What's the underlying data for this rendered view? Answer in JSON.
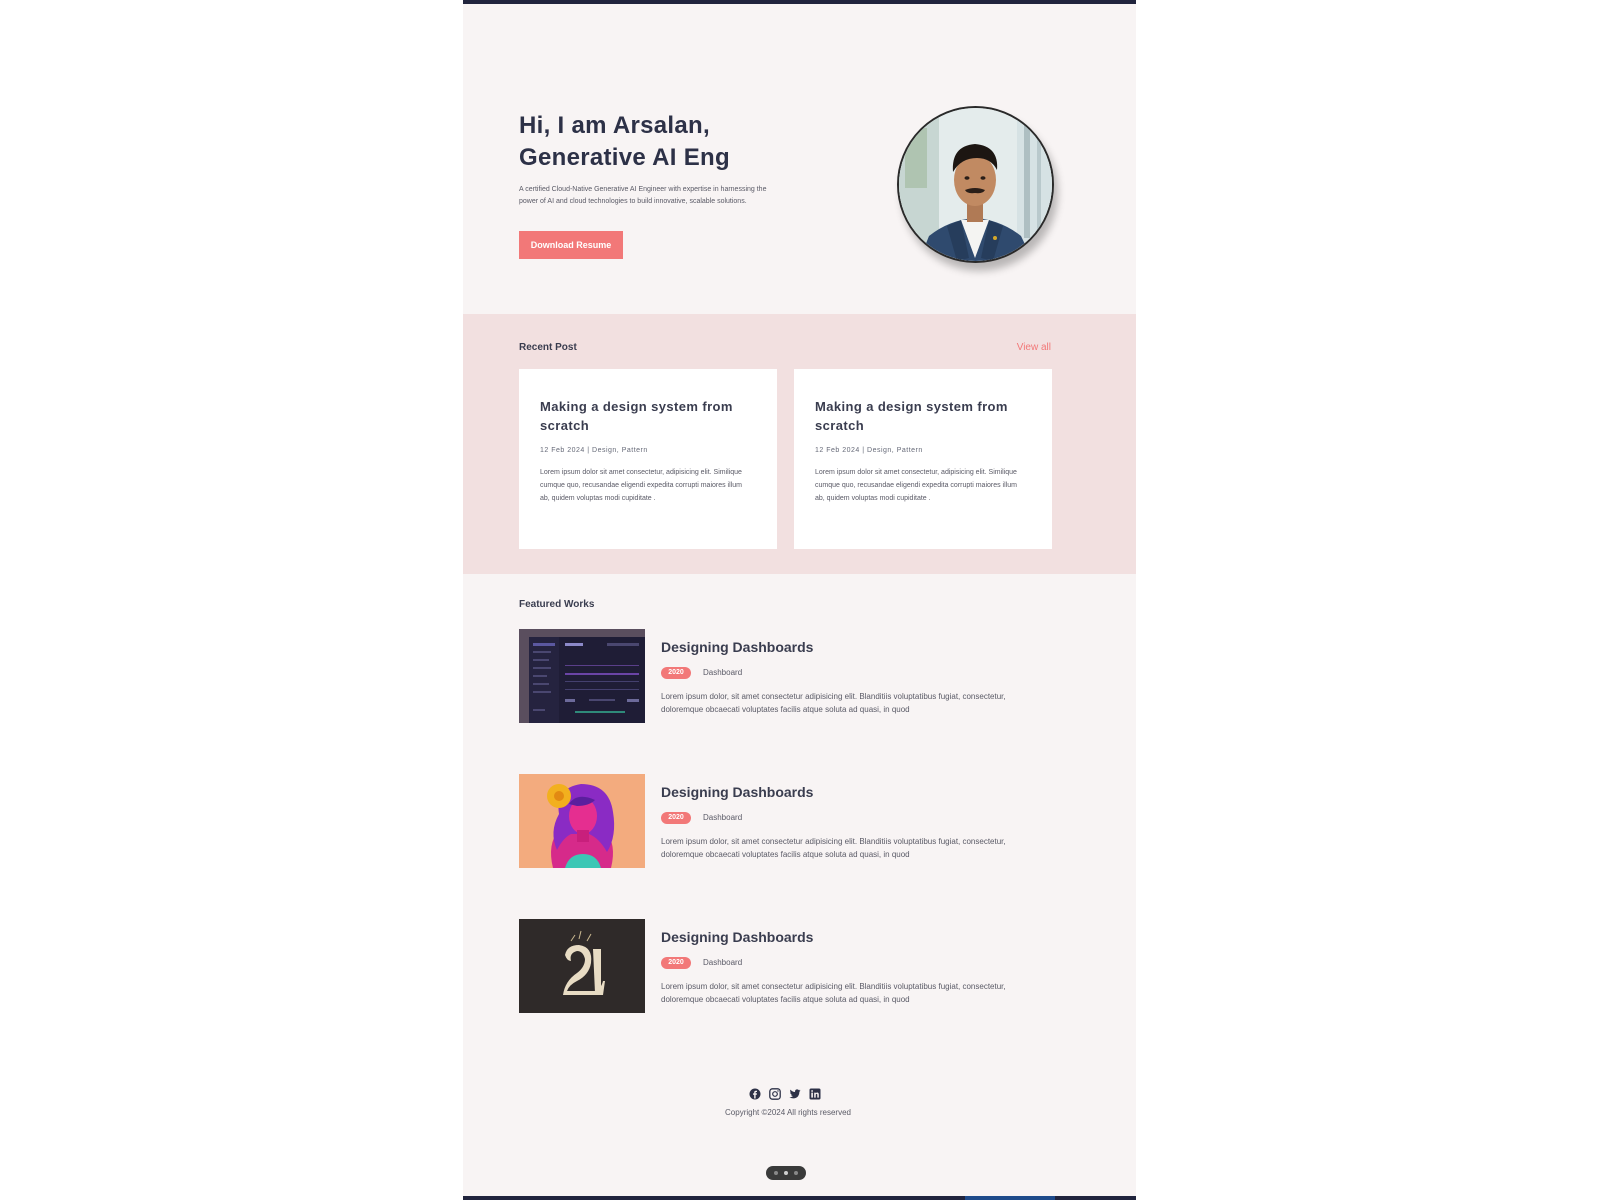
{
  "hero": {
    "title_line1": "Hi, I am Arsalan,",
    "title_line2": "Generative AI Eng",
    "description": "A certified Cloud-Native Generative AI Engineer with expertise in harnessing the power of AI and cloud technologies to build innovative, scalable solutions.",
    "button_label": "Download Resume",
    "avatar_icon": "profile-photo"
  },
  "recent_posts": {
    "title": "Recent Post",
    "view_all": "View all",
    "posts": [
      {
        "title": "Making a design system from scratch",
        "meta": "12 Feb 2024 | Design, Pattern",
        "excerpt": "Lorem ipsum dolor sit amet consectetur, adipisicing elit. Similique cumque quo, recusandae eligendi expedita corrupti maiores illum ab, quidem voluptas modi cupiditate ."
      },
      {
        "title": "Making a design system from scratch",
        "meta": "12 Feb 2024 | Design, Pattern",
        "excerpt": "Lorem ipsum dolor sit amet consectetur, adipisicing elit. Similique cumque quo, recusandae eligendi expedita corrupti maiores illum ab, quidem voluptas modi cupiditate ."
      }
    ]
  },
  "featured": {
    "title": "Featured Works",
    "works": [
      {
        "title": "Designing Dashboards",
        "year": "2020",
        "tag": "Dashboard",
        "description": "Lorem ipsum dolor, sit amet consectetur adipisicing elit. Blanditiis voluptatibus fugiat, consectetur, doloremque obcaecati voluptates facilis atque soluta ad quasi, in quod",
        "thumb_icon": "dashboard-thumbnail"
      },
      {
        "title": "Designing Dashboards",
        "year": "2020",
        "tag": "Dashboard",
        "description": "Lorem ipsum dolor, sit amet consectetur adipisicing elit. Blanditiis voluptatibus fugiat, consectetur, doloremque obcaecati voluptates facilis atque soluta ad quasi, in quod",
        "thumb_icon": "illustration-thumbnail"
      },
      {
        "title": "Designing Dashboards",
        "year": "2020",
        "tag": "Dashboard",
        "description": "Lorem ipsum dolor, sit amet consectetur adipisicing elit. Blanditiis voluptatibus fugiat, consectetur, doloremque obcaecati voluptates facilis atque soluta ad quasi, in quod",
        "thumb_icon": "typography-thumbnail"
      }
    ]
  },
  "footer": {
    "social_icons": [
      "facebook-icon",
      "instagram-icon",
      "twitter-icon",
      "linkedin-icon"
    ],
    "copyright": "Copyright ©2024 All rights reserved"
  },
  "colors": {
    "accent": "#f27878",
    "dark_text": "#2d3147",
    "page_bg": "#f8f4f4",
    "recent_bg": "#f2e0e0"
  }
}
